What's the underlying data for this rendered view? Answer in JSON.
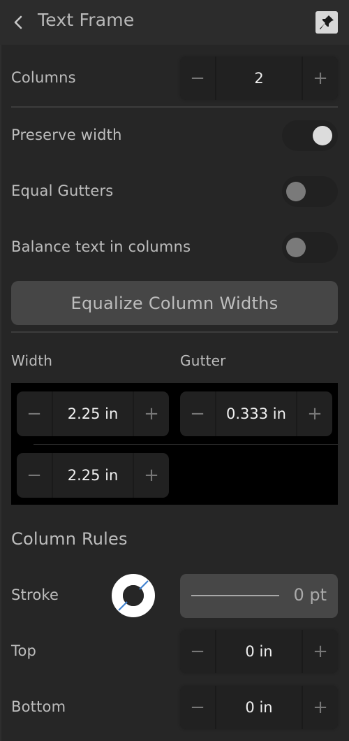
{
  "header": {
    "title": "Text Frame",
    "back_icon": "chevron-left-icon",
    "pin_icon": "pin-icon"
  },
  "columns": {
    "label": "Columns",
    "value": "2",
    "minus": "−",
    "plus": "+"
  },
  "toggles": [
    {
      "label": "Preserve width",
      "on": true
    },
    {
      "label": "Equal Gutters",
      "on": false
    },
    {
      "label": "Balance text in columns",
      "on": false
    }
  ],
  "equalize_button": "Equalize Column Widths",
  "column_sizes": {
    "width_label": "Width",
    "gutter_label": "Gutter",
    "rows": [
      {
        "width": "2.25 in",
        "gutter": "0.333 in"
      },
      {
        "width": "2.25 in"
      }
    ],
    "minus": "−",
    "plus": "+"
  },
  "column_rules": {
    "heading": "Column Rules",
    "stroke_label": "Stroke",
    "stroke_value": "0 pt",
    "stroke_color_icon": "stroke-color-swatch-icon",
    "top_label": "Top",
    "top_value": "0 in",
    "bottom_label": "Bottom",
    "bottom_value": "0 in",
    "minus": "−",
    "plus": "+"
  },
  "colors": {
    "background": "#262626",
    "header": "#2c2c2c",
    "swatch_slash": "#3b7fd0"
  }
}
